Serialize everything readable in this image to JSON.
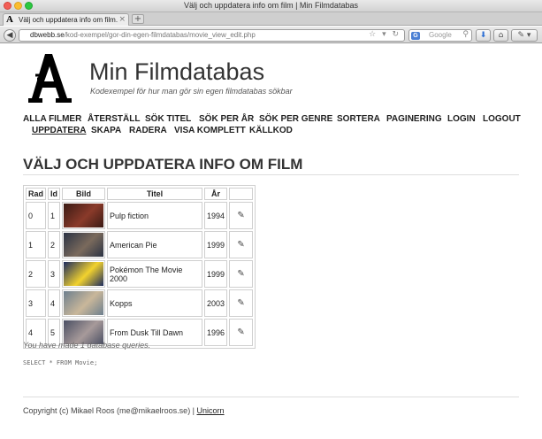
{
  "window": {
    "title": "Välj och uppdatera info om film | Min Filmdatabas"
  },
  "tab": {
    "label": "Välj och uppdatera info om film...",
    "favicon": "A"
  },
  "browser": {
    "url_host": "dbwebb.se",
    "url_path": "/kod-exempel/gor-din-egen-filmdatabas/movie_view_edit.php",
    "search_placeholder": "Google",
    "search_engine_letter": "G"
  },
  "site": {
    "title": "Min Filmdatabas",
    "slogan": "Kodexempel för hur man gör sin egen filmdatabas sökbar"
  },
  "menu": {
    "items": [
      {
        "label": "ALLA FILMER"
      },
      {
        "label": "ÅTERSTÄLL"
      },
      {
        "label": "SÖK TITEL"
      },
      {
        "label": "SÖK PER ÅR"
      },
      {
        "label": "SÖK PER GENRE"
      },
      {
        "label": "SORTERA"
      },
      {
        "label": "PAGINERING"
      },
      {
        "label": "LOGIN"
      },
      {
        "label": "LOGOUT"
      },
      {
        "label": "UPPDATERA",
        "selected": true
      },
      {
        "label": "SKAPA"
      },
      {
        "label": "RADERA"
      },
      {
        "label": "VISA KOMPLETT"
      },
      {
        "label": "KÄLLKOD"
      }
    ]
  },
  "heading": "VÄLJ OCH UPPDATERA INFO OM FILM",
  "table": {
    "headers": [
      "Rad",
      "Id",
      "Bild",
      "Titel",
      "År",
      ""
    ],
    "rows": [
      {
        "rad": "0",
        "id": "1",
        "title": "Pulp fiction",
        "year": "1994",
        "thumb_colors": [
          "#3a1a14",
          "#8a3a2a"
        ]
      },
      {
        "rad": "1",
        "id": "2",
        "title": "American Pie",
        "year": "1999",
        "thumb_colors": [
          "#2b3344",
          "#7a6a5c"
        ]
      },
      {
        "rad": "2",
        "id": "3",
        "title": "Pokémon The Movie 2000",
        "year": "1999",
        "thumb_colors": [
          "#1c2a5e",
          "#f2d22e"
        ]
      },
      {
        "rad": "3",
        "id": "4",
        "title": "Kopps",
        "year": "2003",
        "thumb_colors": [
          "#6d7f8e",
          "#c9b79a"
        ]
      },
      {
        "rad": "4",
        "id": "5",
        "title": "From Dusk Till Dawn",
        "year": "1996",
        "thumb_colors": [
          "#4a4f63",
          "#a79a9a"
        ]
      }
    ],
    "edit_icon": "edit-icon"
  },
  "query_info": "You have made 1 database queries.",
  "sql": "SELECT * FROM Movie;",
  "footer": {
    "text": "Copyright (c) Mikael Roos (me@mikaelroos.se) | ",
    "link": "Unicorn"
  }
}
